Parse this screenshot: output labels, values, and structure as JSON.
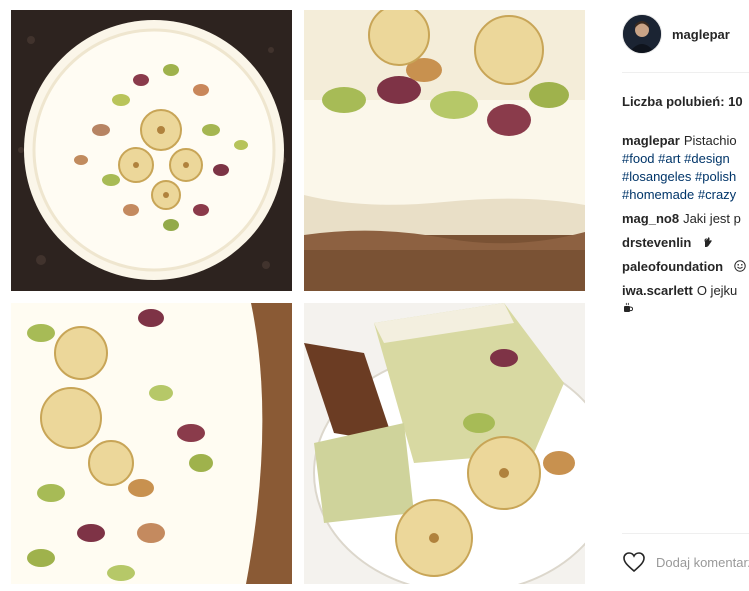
{
  "post": {
    "username": "maglepar",
    "likes_text": "Liczba polubień: 10",
    "caption": {
      "user": "maglepar",
      "text": "Pistachio",
      "hashtag_lines": [
        "#food #art #design",
        "#losangeles #polish",
        "#homemade #crazy"
      ]
    },
    "comments": [
      {
        "user": "mag_no8",
        "text": "Jaki jest p"
      },
      {
        "user": "drstevenlin",
        "text": "",
        "icon": "ok-hand-icon"
      },
      {
        "user": "paleofoundation",
        "text": "",
        "icon": "smile-icon"
      },
      {
        "user": "iwa.scarlett",
        "text": "O jejku",
        "icon": "coffee-icon"
      }
    ],
    "add_comment_placeholder": "Dodaj komentarz..."
  },
  "colors": {
    "hashtag": "#003569",
    "text": "#262626",
    "placeholder": "#999999",
    "divider": "#efefef"
  }
}
